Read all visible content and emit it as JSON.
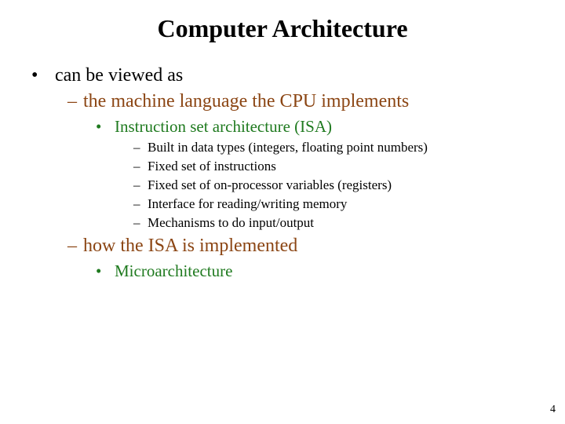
{
  "title": "Computer Architecture",
  "bullet1": "can be viewed as",
  "sub1": "the machine language the CPU implements",
  "sub1a": "Instruction set architecture (ISA)",
  "isa_items": [
    "Built in data types (integers, floating point numbers)",
    "Fixed set of instructions",
    "Fixed set of on-processor variables (registers)",
    "Interface for reading/writing memory",
    "Mechanisms to do input/output"
  ],
  "sub2": "how the ISA is implemented",
  "sub2a": "Microarchitecture",
  "page_number": "4",
  "markers": {
    "disc": "•",
    "dash": "–"
  }
}
